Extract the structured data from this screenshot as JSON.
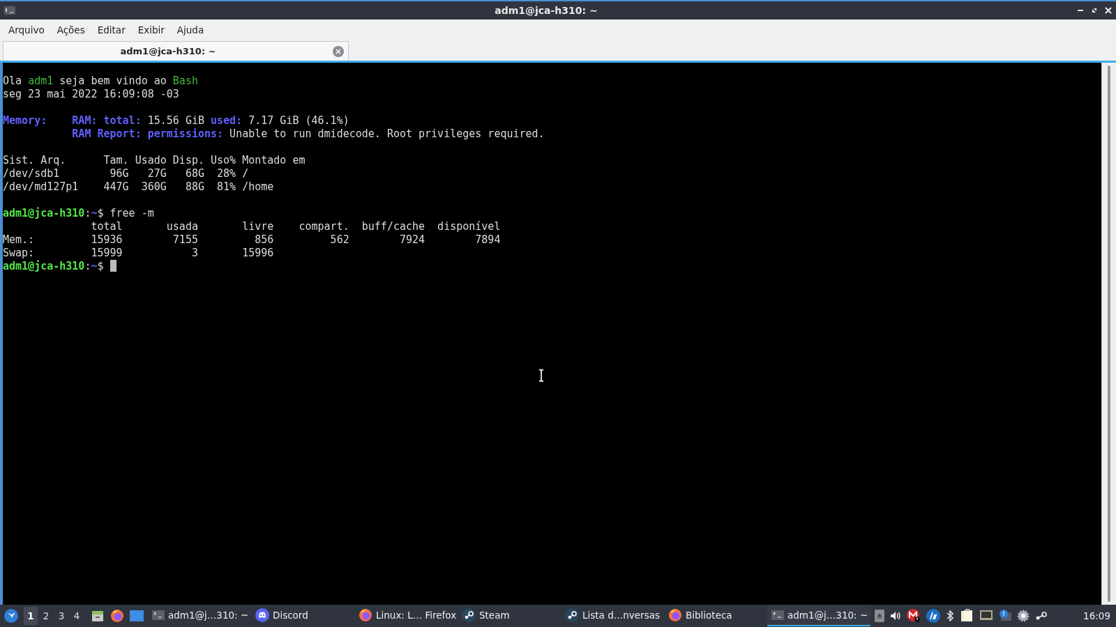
{
  "window": {
    "title": "adm1@jca-h310: ~"
  },
  "menu": [
    "Arquivo",
    "Ações",
    "Editar",
    "Exibir",
    "Ajuda"
  ],
  "tabs": [
    {
      "label": "adm1@jca-h310: ~",
      "selected": true
    }
  ],
  "terminal": {
    "blocks": [
      [
        [
          {
            "text": "Ola ",
            "kind": "plain"
          },
          {
            "text": "adm1",
            "kind": "green"
          },
          {
            "text": " seja bem vindo ao ",
            "kind": "plain"
          },
          {
            "text": "Bash",
            "kind": "green"
          }
        ],
        [
          {
            "text": "seg 23 mai 2022 16:09:08 -03",
            "kind": "plain"
          }
        ]
      ],
      [
        [
          {
            "text": "Memory:",
            "kind": "label"
          },
          {
            "text": "    RAM: total:",
            "kind": "label"
          },
          {
            "text": " 15.56 GiB ",
            "kind": "plain"
          },
          {
            "text": "used:",
            "kind": "label"
          },
          {
            "text": " 7.17 GiB (46.1%)",
            "kind": "plain"
          }
        ],
        [
          {
            "text": "           RAM Report: permissions:",
            "kind": "label"
          },
          {
            "text": " Unable to run dmidecode. Root privileges required.",
            "kind": "plain"
          }
        ]
      ],
      [
        [
          {
            "text": "Sist. Arq.      Tam. Usado Disp. Uso% Montado em",
            "kind": "plain"
          }
        ],
        [
          {
            "text": "/dev/sdb1        96G   27G   68G  28% /",
            "kind": "plain"
          }
        ],
        [
          {
            "text": "/dev/md127p1    447G  360G   88G  81% /home",
            "kind": "plain"
          }
        ]
      ],
      [
        [
          {
            "text": "adm1@jca-h310",
            "kind": "prompt-user"
          },
          {
            "text": ":",
            "kind": "plain"
          },
          {
            "text": "~",
            "kind": "prompt-path"
          },
          {
            "text": "$ free -m",
            "kind": "plain"
          }
        ],
        [
          {
            "text": "              total       usada       livre    compart.  buff/cache  disponível",
            "kind": "plain"
          }
        ],
        [
          {
            "text": "Mem.:         15936        7155         856         562        7924        7894",
            "kind": "plain"
          }
        ],
        [
          {
            "text": "Swap:         15999           3       15996",
            "kind": "plain"
          }
        ],
        [
          {
            "text": "adm1@jca-h310",
            "kind": "prompt-user"
          },
          {
            "text": ":",
            "kind": "plain"
          },
          {
            "text": "~",
            "kind": "prompt-path"
          },
          {
            "text": "$",
            "kind": "plain"
          }
        ]
      ]
    ]
  },
  "taskbar": {
    "workspaces": [
      {
        "label": "1",
        "selected": true
      },
      {
        "label": "2",
        "selected": false
      },
      {
        "label": "3",
        "selected": false
      },
      {
        "label": "4",
        "selected": false
      }
    ],
    "tasks": [
      {
        "label": "adm1@j…310: ~",
        "kind": "terminal",
        "selected": false
      },
      {
        "label": "Discord",
        "kind": "discord",
        "selected": false
      },
      {
        "label": "Linux: L… Firefox",
        "kind": "firefox",
        "selected": false
      },
      {
        "label": "Steam",
        "kind": "steam",
        "selected": false
      },
      {
        "label": "Lista d…nversas",
        "kind": "steam",
        "selected": false
      },
      {
        "label": "Biblioteca",
        "kind": "firefox",
        "selected": false
      },
      {
        "label": "adm1@j…310: ~",
        "kind": "terminal",
        "selected": true
      }
    ],
    "clock": "16:09"
  }
}
